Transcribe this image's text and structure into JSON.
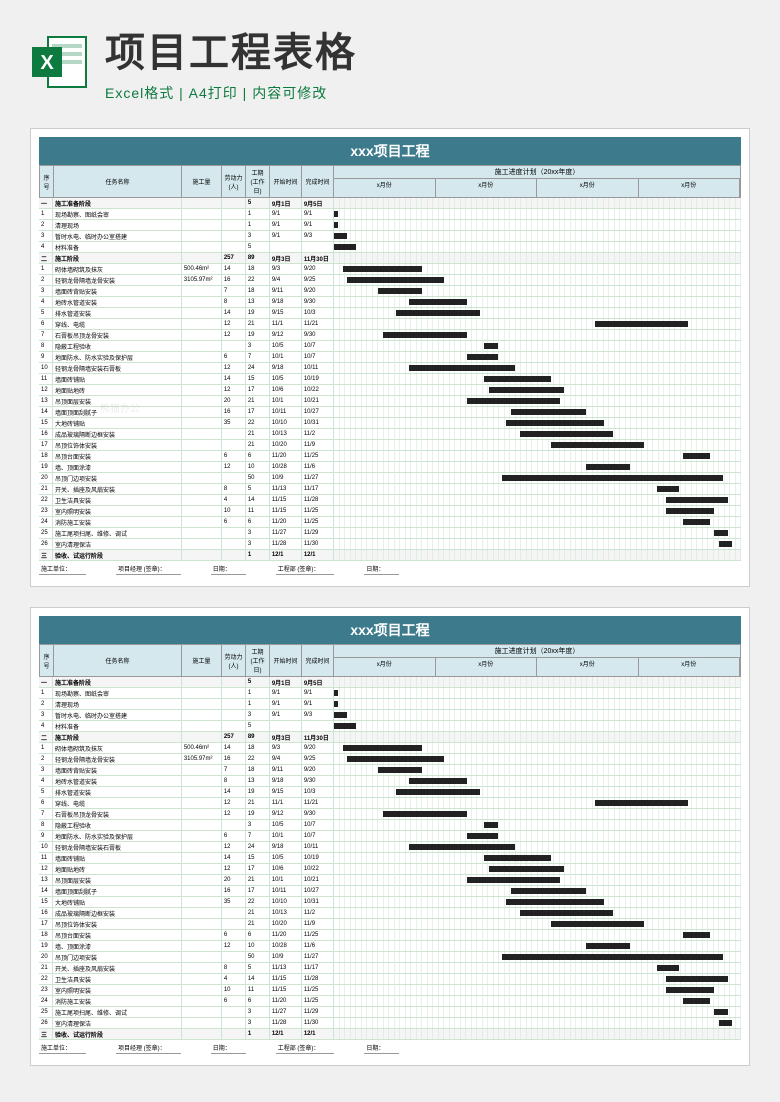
{
  "header": {
    "main_title": "项目工程表格",
    "sub_title": "Excel格式 | A4打印 | 内容可修改"
  },
  "sheet": {
    "title": "xxx项目工程",
    "plan_title": "施工进度计划（20xx年度）",
    "columns": {
      "num": "序号",
      "name": "任务名称",
      "area": "施工量",
      "labor": "劳动力(人)",
      "days": "工期(工作日)",
      "start": "开始时间",
      "end": "完成时间"
    },
    "months": [
      "x月份",
      "x月份",
      "x月份",
      "x月份"
    ],
    "sections": [
      {
        "num": "一",
        "name": "施工准备阶段",
        "labor": "",
        "days": "5",
        "start": "9月1日",
        "end": "9月5日",
        "type": "section"
      },
      {
        "num": "1",
        "name": "现场勘察、图纸会审",
        "labor": "",
        "days": "1",
        "start": "9/1",
        "end": "9/1",
        "bar": [
          0,
          1
        ]
      },
      {
        "num": "2",
        "name": "清理现场",
        "labor": "",
        "days": "1",
        "start": "9/1",
        "end": "9/1",
        "bar": [
          0,
          1
        ]
      },
      {
        "num": "3",
        "name": "暂时水电、临时办公室搭建",
        "labor": "",
        "days": "3",
        "start": "9/1",
        "end": "9/3",
        "bar": [
          0,
          3
        ]
      },
      {
        "num": "4",
        "name": "材料准备",
        "labor": "",
        "days": "5",
        "start": "",
        "end": "",
        "bar": [
          0,
          5
        ]
      },
      {
        "num": "二",
        "name": "施工阶段",
        "labor": "257",
        "days": "89",
        "start": "9月3日",
        "end": "11月30日",
        "type": "section"
      },
      {
        "num": "1",
        "name": "砌体墙砌筑及抹灰",
        "area": "500.46m²",
        "labor": "14",
        "days": "18",
        "start": "9/3",
        "end": "9/20",
        "bar": [
          2,
          18
        ]
      },
      {
        "num": "2",
        "name": "轻钢龙骨隔墙龙骨安装",
        "area": "3105.97m²",
        "labor": "16",
        "days": "22",
        "start": "9/4",
        "end": "9/25",
        "bar": [
          3,
          22
        ]
      },
      {
        "num": "3",
        "name": "墙面砖背贴安装",
        "labor": "7",
        "days": "18",
        "start": "9/11",
        "end": "9/20",
        "bar": [
          10,
          10
        ]
      },
      {
        "num": "4",
        "name": "地砖水管道安装",
        "labor": "8",
        "days": "13",
        "start": "9/18",
        "end": "9/30",
        "bar": [
          17,
          13
        ]
      },
      {
        "num": "5",
        "name": "排水管道安装",
        "labor": "14",
        "days": "19",
        "start": "9/15",
        "end": "10/3",
        "bar": [
          14,
          19
        ]
      },
      {
        "num": "6",
        "name": "穿线、电缆",
        "labor": "12",
        "days": "21",
        "start": "11/1",
        "end": "11/21",
        "bar": [
          59,
          21
        ]
      },
      {
        "num": "7",
        "name": "石膏板吊顶龙骨安装",
        "labor": "12",
        "days": "19",
        "start": "9/12",
        "end": "9/30",
        "bar": [
          11,
          19
        ]
      },
      {
        "num": "8",
        "name": "隐蔽工程验收",
        "labor": "",
        "days": "3",
        "start": "10/5",
        "end": "10/7",
        "bar": [
          34,
          3
        ]
      },
      {
        "num": "9",
        "name": "地面防水、防水实验及保护层",
        "labor": "6",
        "days": "7",
        "start": "10/1",
        "end": "10/7",
        "bar": [
          30,
          7
        ]
      },
      {
        "num": "10",
        "name": "轻钢龙骨隔墙安装石膏板",
        "labor": "12",
        "days": "24",
        "start": "9/18",
        "end": "10/11",
        "bar": [
          17,
          24
        ]
      },
      {
        "num": "11",
        "name": "墙面砖铺贴",
        "labor": "14",
        "days": "15",
        "start": "10/5",
        "end": "10/19",
        "bar": [
          34,
          15
        ]
      },
      {
        "num": "12",
        "name": "地面贴地砖",
        "labor": "12",
        "days": "17",
        "start": "10/6",
        "end": "10/22",
        "bar": [
          35,
          17
        ]
      },
      {
        "num": "13",
        "name": "吊顶面层安装",
        "labor": "20",
        "days": "21",
        "start": "10/1",
        "end": "10/21",
        "bar": [
          30,
          21
        ]
      },
      {
        "num": "14",
        "name": "墙面顶面刮腻子",
        "labor": "16",
        "days": "17",
        "start": "10/11",
        "end": "10/27",
        "bar": [
          40,
          17
        ]
      },
      {
        "num": "15",
        "name": "大地砖铺贴",
        "labor": "35",
        "days": "22",
        "start": "10/10",
        "end": "10/31",
        "bar": [
          39,
          22
        ]
      },
      {
        "num": "16",
        "name": "成品玻璃隔断边框安装",
        "labor": "",
        "days": "21",
        "start": "10/13",
        "end": "11/2",
        "bar": [
          42,
          21
        ]
      },
      {
        "num": "17",
        "name": "吊顶位饰体安装",
        "labor": "",
        "days": "21",
        "start": "10/20",
        "end": "11/9",
        "bar": [
          49,
          21
        ]
      },
      {
        "num": "18",
        "name": "吊顶台面安装",
        "labor": "6",
        "days": "6",
        "start": "11/20",
        "end": "11/25",
        "bar": [
          79,
          6
        ]
      },
      {
        "num": "19",
        "name": "墙、顶面涂漆",
        "labor": "12",
        "days": "10",
        "start": "10/28",
        "end": "11/6",
        "bar": [
          57,
          10
        ]
      },
      {
        "num": "20",
        "name": "吊顶门边项安装",
        "labor": "",
        "days": "50",
        "start": "10/9",
        "end": "11/27",
        "bar": [
          38,
          50
        ]
      },
      {
        "num": "21",
        "name": "开关、插座及风扇安装",
        "labor": "8",
        "days": "5",
        "start": "11/13",
        "end": "11/17",
        "bar": [
          73,
          5
        ]
      },
      {
        "num": "22",
        "name": "卫生洁具安装",
        "labor": "4",
        "days": "14",
        "start": "11/15",
        "end": "11/28",
        "bar": [
          75,
          14
        ]
      },
      {
        "num": "23",
        "name": "室内照明安装",
        "labor": "10",
        "days": "11",
        "start": "11/15",
        "end": "11/25",
        "bar": [
          75,
          11
        ]
      },
      {
        "num": "24",
        "name": "消防施工安装",
        "labor": "6",
        "days": "6",
        "start": "11/20",
        "end": "11/25",
        "bar": [
          79,
          6
        ]
      },
      {
        "num": "25",
        "name": "施工尾项扫尾、维修、调试",
        "labor": "",
        "days": "3",
        "start": "11/27",
        "end": "11/29",
        "bar": [
          86,
          3
        ]
      },
      {
        "num": "26",
        "name": "室内清理保洁",
        "labor": "",
        "days": "3",
        "start": "11/28",
        "end": "11/30",
        "bar": [
          87,
          3
        ]
      },
      {
        "num": "三",
        "name": "验收、试运行阶段",
        "labor": "",
        "days": "1",
        "start": "12/1",
        "end": "12/1",
        "type": "section"
      }
    ],
    "footer": {
      "unit": "施工单位：",
      "manager": "项目经理 (签章)：",
      "date1": "日期：",
      "dept": "工程部 (签章)：",
      "date2": "日期："
    }
  },
  "watermark": "熊猫办公"
}
